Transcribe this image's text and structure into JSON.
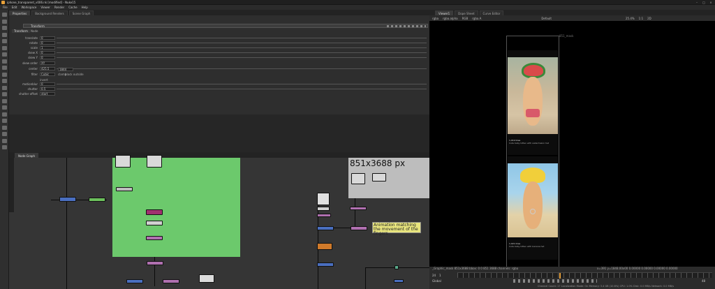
{
  "window": {
    "title": "iphone_transparent_v006.nk [modified] - Nuke15"
  },
  "menu": [
    "File",
    "Edit",
    "Workspace",
    "Viewer",
    "Render",
    "Cache",
    "Help"
  ],
  "left_panel_tabs": [
    "Properties",
    "Background Renders",
    "Scene Graph"
  ],
  "properties": {
    "node_name": "Transform",
    "subtabs": [
      "Transform",
      "Node"
    ],
    "rows": [
      {
        "label": "translate",
        "value": "0"
      },
      {
        "label": "rotate",
        "value": "0"
      },
      {
        "label": "scale",
        "value": "1"
      },
      {
        "label": "skew X",
        "value": "0"
      },
      {
        "label": "skew Y",
        "value": "0"
      },
      {
        "label": "skew order",
        "value": "XY"
      },
      {
        "label": "center",
        "value": "425.5"
      },
      {
        "label": "filter",
        "value": "Cubic"
      },
      {
        "label": "motionblur",
        "value": "0"
      },
      {
        "label": "shutter",
        "value": "0.5"
      },
      {
        "label": "shutter offset",
        "value": "start"
      }
    ],
    "center_y": "1844",
    "invert_label": "invert",
    "clamp_label": "clamp",
    "black_outside_label": "black outside"
  },
  "nodegraph": {
    "tab": "Node Graph",
    "backdrop_label": "851x3688 px",
    "sticky_note": "Animation matching the movement of the fingers"
  },
  "viewer": {
    "tabs": [
      "Viewer1",
      "Curve Editor",
      "Dope Sheet"
    ],
    "channels": "rgba",
    "channel_sel": "rgba.alpha",
    "layer": "RGB",
    "pipe": "rgba.A",
    "view_mode": "Default",
    "zoom": "25.4%",
    "aspect": "1:1",
    "mode": "2D",
    "format_label_top": "851_mask",
    "format_label_bottom": "iphone_mask",
    "status_left": "_Graphic_mask 851x3688  bbox: 0 0 851 3688 channels: rgba",
    "status_right": "x=391 y=1848.00x00  0.00000  0.00000  0.00000  0.00000",
    "fps": "24",
    "frame": "1",
    "frame_end": "48",
    "range_label": "Global"
  },
  "instagram": {
    "top_post": {
      "likes": "1,019 likes",
      "caption": "Cute baby kitten with watermelon hat"
    },
    "bottom_post": {
      "likes": "1,021 likes",
      "caption": "Cute baby kitten with banana hat"
    }
  },
  "statusbar": "Channel Count: 17  Localization Mode: On  Memory: 3.4 GB (10.6%)  CPU: 1.0%  Disk: 0.0 MB/s  Network: 0.0 MB/s"
}
